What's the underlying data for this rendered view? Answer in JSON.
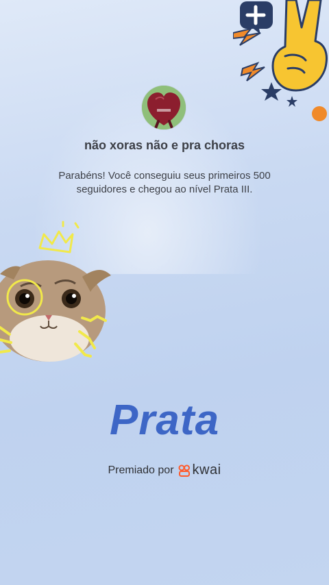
{
  "profile": {
    "avatar_icon": "heart-bag-avatar",
    "username": "não xoras não e pra choras",
    "message": "Parabéns! Você conseguiu seus primeiros 500 seguidores e chegou ao nível Prata III."
  },
  "level": {
    "title": "Prata",
    "color": "#3d66c6"
  },
  "award": {
    "prefix": "Premiado por",
    "brand": "kwai",
    "brand_color": "#ff5a2a"
  },
  "decorations": {
    "top_right": "peace-hand-sticker-icon",
    "left": "cat-crown-sticker-icon"
  }
}
